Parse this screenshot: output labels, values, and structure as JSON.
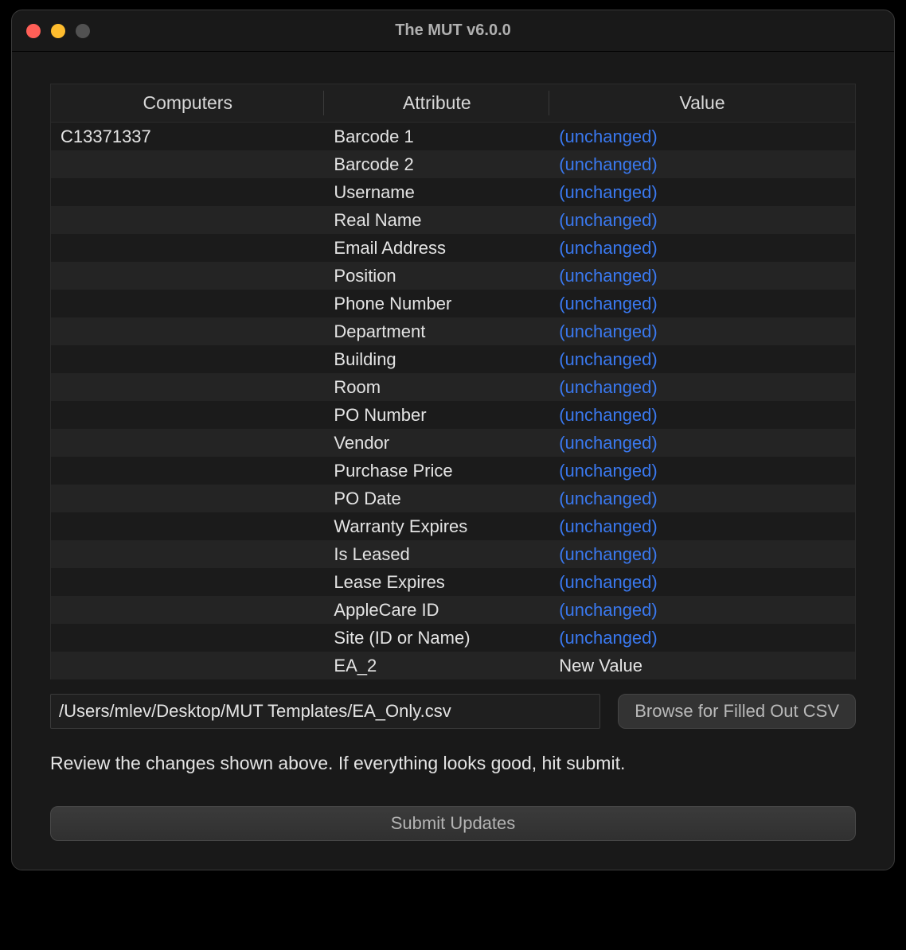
{
  "titlebar": {
    "title": "The MUT v6.0.0"
  },
  "table": {
    "columns": {
      "computers": "Computers",
      "attribute": "Attribute",
      "value": "Value"
    },
    "unchanged_text": "(unchanged)",
    "rows": [
      {
        "computer": "C13371337",
        "attribute": "Barcode 1",
        "value": "(unchanged)",
        "unchanged": true
      },
      {
        "computer": "",
        "attribute": "Barcode 2",
        "value": "(unchanged)",
        "unchanged": true
      },
      {
        "computer": "",
        "attribute": "Username",
        "value": "(unchanged)",
        "unchanged": true
      },
      {
        "computer": "",
        "attribute": "Real Name",
        "value": "(unchanged)",
        "unchanged": true
      },
      {
        "computer": "",
        "attribute": "Email Address",
        "value": "(unchanged)",
        "unchanged": true
      },
      {
        "computer": "",
        "attribute": "Position",
        "value": "(unchanged)",
        "unchanged": true
      },
      {
        "computer": "",
        "attribute": "Phone Number",
        "value": "(unchanged)",
        "unchanged": true
      },
      {
        "computer": "",
        "attribute": "Department",
        "value": "(unchanged)",
        "unchanged": true
      },
      {
        "computer": "",
        "attribute": "Building",
        "value": "(unchanged)",
        "unchanged": true
      },
      {
        "computer": "",
        "attribute": "Room",
        "value": "(unchanged)",
        "unchanged": true
      },
      {
        "computer": "",
        "attribute": "PO Number",
        "value": "(unchanged)",
        "unchanged": true
      },
      {
        "computer": "",
        "attribute": "Vendor",
        "value": "(unchanged)",
        "unchanged": true
      },
      {
        "computer": "",
        "attribute": "Purchase Price",
        "value": "(unchanged)",
        "unchanged": true
      },
      {
        "computer": "",
        "attribute": "PO Date",
        "value": "(unchanged)",
        "unchanged": true
      },
      {
        "computer": "",
        "attribute": "Warranty Expires",
        "value": "(unchanged)",
        "unchanged": true
      },
      {
        "computer": "",
        "attribute": "Is Leased",
        "value": "(unchanged)",
        "unchanged": true
      },
      {
        "computer": "",
        "attribute": "Lease Expires",
        "value": "(unchanged)",
        "unchanged": true
      },
      {
        "computer": "",
        "attribute": "AppleCare ID",
        "value": "(unchanged)",
        "unchanged": true
      },
      {
        "computer": "",
        "attribute": "Site (ID or Name)",
        "value": "(unchanged)",
        "unchanged": true
      },
      {
        "computer": "",
        "attribute": "EA_2",
        "value": "New Value",
        "unchanged": false
      }
    ]
  },
  "csv_path": "/Users/mlev/Desktop/MUT Templates/EA_Only.csv",
  "browse_label": "Browse for Filled Out CSV",
  "instruction": "Review the changes shown above. If everything looks good, hit submit.",
  "submit_label": "Submit Updates"
}
